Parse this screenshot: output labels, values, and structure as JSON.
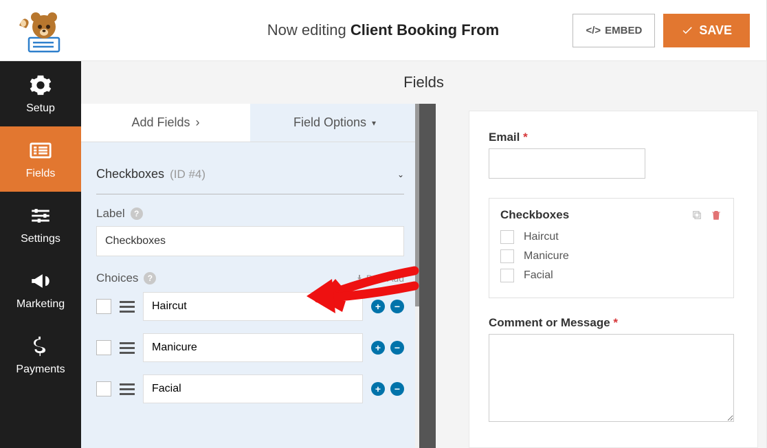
{
  "header": {
    "editing_prefix": "Now editing ",
    "form_name": "Client Booking From",
    "embed_label": "EMBED",
    "save_label": "SAVE"
  },
  "sidebar": {
    "items": [
      {
        "label": "Setup"
      },
      {
        "label": "Fields"
      },
      {
        "label": "Settings"
      },
      {
        "label": "Marketing"
      },
      {
        "label": "Payments"
      }
    ],
    "active_index": 1
  },
  "main": {
    "title": "Fields",
    "tabs": {
      "add_fields": "Add Fields",
      "field_options": "Field Options"
    }
  },
  "field_options": {
    "section_title": "Checkboxes",
    "section_id": "(ID #4)",
    "label_label": "Label",
    "label_value": "Checkboxes",
    "choices_label": "Choices",
    "bulk_add": "Bulk Add",
    "choices": [
      {
        "value": "Haircut"
      },
      {
        "value": "Manicure"
      },
      {
        "value": "Facial"
      }
    ]
  },
  "preview": {
    "email_label": "Email",
    "checkbox_group_label": "Checkboxes",
    "checkbox_items": [
      "Haircut",
      "Manicure",
      "Facial"
    ],
    "comment_label": "Comment or Message"
  }
}
